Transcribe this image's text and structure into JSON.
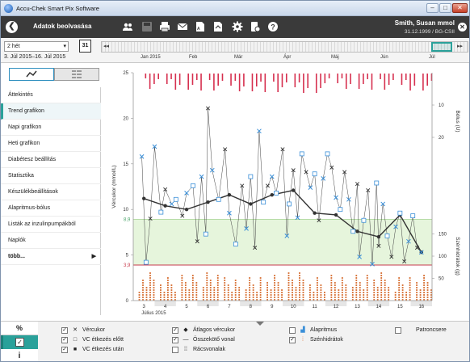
{
  "window": {
    "title": "Accu-Chek Smart Pix Software",
    "min": "–",
    "max": "□",
    "close": "✕"
  },
  "toolbar": {
    "back_icon": "arrow-left-icon",
    "title": "Adatok beolvasása",
    "icons": [
      "users-icon",
      "save-icon",
      "print-icon",
      "mail-icon",
      "pdf-icon",
      "pdf-export-icon",
      "gear-icon",
      "device-settings-icon",
      "help-icon"
    ],
    "user_name": "Smith, Susan mmol",
    "user_sub": "31.12.1999 / BG-CSII",
    "close_icon": "close-icon"
  },
  "range": {
    "period_value": "2 hét",
    "calendar_day": "31",
    "date_range": "3. Júl 2015–16. Júl 2015",
    "months": [
      "Jan 2015",
      "Feb",
      "Már",
      "Ápr",
      "Máj",
      "Jún",
      "Júl"
    ]
  },
  "nav": {
    "items": [
      {
        "label": "Áttekintés"
      },
      {
        "label": "Trend grafikon"
      },
      {
        "label": "Napi grafikon"
      },
      {
        "label": "Heti grafikon"
      },
      {
        "label": "Diabétesz beállítás"
      },
      {
        "label": "Statisztika"
      },
      {
        "label": "Készülékbeállítások"
      },
      {
        "label": "Alapritmus-bólus"
      },
      {
        "label": "Listák az inzulinpumpákból"
      },
      {
        "label": "Naplók"
      },
      {
        "label": "több..."
      }
    ],
    "active_index": 1
  },
  "chart_data": {
    "type": "line",
    "ylabel": "Vércukor (mmol/L)",
    "ylabel_right_top": "Bólus (U)",
    "ylabel_right_bottom": "Szénhidrátok (g)",
    "ylim": [
      0,
      25
    ],
    "yticks": [
      0,
      5,
      10,
      15,
      20,
      25
    ],
    "xlim": [
      2.5,
      16.5
    ],
    "xticks": [
      3,
      4,
      5,
      6,
      7,
      8,
      9,
      10,
      11,
      12,
      13,
      14,
      15,
      16
    ],
    "xsub": "Július 2015",
    "target_range": [
      3.9,
      8.9
    ],
    "target_labels": [
      "3,9",
      "8,9"
    ],
    "bolus_ticks": [
      10,
      20
    ],
    "carb_ticks": [
      50,
      100,
      150
    ],
    "average_line": [
      [
        3,
        11.2
      ],
      [
        4,
        10.4
      ],
      [
        5,
        10.0
      ],
      [
        6,
        10.8
      ],
      [
        7,
        11.6
      ],
      [
        8,
        10.6
      ],
      [
        9,
        11.6
      ],
      [
        10,
        12.1
      ],
      [
        11,
        9.6
      ],
      [
        12,
        9.4
      ],
      [
        13,
        7.6
      ],
      [
        14,
        7.0
      ],
      [
        15,
        9.4
      ],
      [
        16,
        5.3
      ]
    ],
    "glucose_series": [
      {
        "name": "Vércukor",
        "values": [
          [
            2.9,
            15.8
          ],
          [
            3.1,
            4.2
          ],
          [
            3.3,
            9.0
          ],
          [
            3.5,
            16.9
          ],
          [
            3.8,
            9.7
          ],
          [
            4.0,
            12.2
          ],
          [
            4.3,
            10.6
          ],
          [
            4.5,
            11.1
          ],
          [
            4.8,
            9.3
          ],
          [
            5.0,
            11.8
          ],
          [
            5.3,
            12.6
          ],
          [
            5.5,
            6.5
          ],
          [
            5.7,
            13.6
          ],
          [
            5.9,
            7.3
          ],
          [
            6.0,
            21.1
          ],
          [
            6.2,
            14.3
          ],
          [
            6.5,
            11.1
          ],
          [
            6.8,
            16.6
          ],
          [
            7.0,
            9.6
          ],
          [
            7.3,
            6.2
          ],
          [
            7.6,
            12.6
          ],
          [
            7.8,
            7.9
          ],
          [
            8.0,
            13.6
          ],
          [
            8.2,
            5.8
          ],
          [
            8.4,
            18.6
          ],
          [
            8.6,
            10.8
          ],
          [
            8.8,
            12.6
          ],
          [
            9.0,
            13.6
          ],
          [
            9.2,
            11.8
          ],
          [
            9.5,
            16.6
          ],
          [
            9.7,
            7.1
          ],
          [
            9.8,
            10.6
          ],
          [
            10.0,
            14.3
          ],
          [
            10.2,
            9.1
          ],
          [
            10.4,
            16.1
          ],
          [
            10.6,
            14.1
          ],
          [
            10.8,
            12.4
          ],
          [
            11.0,
            13.9
          ],
          [
            11.2,
            8.8
          ],
          [
            11.4,
            13.4
          ],
          [
            11.6,
            16.1
          ],
          [
            11.8,
            14.6
          ],
          [
            12.0,
            11.3
          ],
          [
            12.2,
            10.0
          ],
          [
            12.4,
            14.1
          ],
          [
            12.6,
            11.1
          ],
          [
            12.8,
            7.6
          ],
          [
            13.0,
            12.8
          ],
          [
            13.1,
            4.8
          ],
          [
            13.3,
            8.8
          ],
          [
            13.5,
            12.1
          ],
          [
            13.7,
            4.0
          ],
          [
            13.9,
            12.9
          ],
          [
            14.0,
            6.0
          ],
          [
            14.2,
            10.6
          ],
          [
            14.4,
            7.1
          ],
          [
            14.6,
            4.8
          ],
          [
            14.8,
            8.1
          ],
          [
            15.0,
            9.6
          ],
          [
            15.2,
            4.3
          ],
          [
            15.4,
            6.5
          ],
          [
            15.6,
            9.3
          ],
          [
            15.8,
            5.8
          ],
          [
            16.0,
            5.3
          ]
        ]
      }
    ],
    "bolus_days": 14,
    "carb_days": 14
  },
  "legend": {
    "side": {
      "pct": "%",
      "check": "✓",
      "info": "i"
    },
    "items": [
      {
        "label": "Vércukor",
        "symbol": "✕",
        "checked": true
      },
      {
        "label": "VC étkezés előtt",
        "symbol": "□",
        "checked": true
      },
      {
        "label": "VC étkezés után",
        "symbol": "■",
        "checked": true
      },
      {
        "label": "Átlagos vércukor",
        "symbol": "◆",
        "checked": true
      },
      {
        "label": "Összekötő vonal",
        "symbol": "—",
        "checked": true
      },
      {
        "label": "Rácsvonalak",
        "symbol": "⁞⁞",
        "checked": false
      },
      {
        "label": "Alapritmus",
        "symbol": "▟",
        "checked": false
      },
      {
        "label": "Szénhidrátok",
        "symbol": "⁞",
        "checked": true
      },
      {
        "label": "Patroncsere",
        "symbol": "",
        "checked": false
      }
    ]
  },
  "colors": {
    "accent": "#2aa19a",
    "bolus": "#d6304f",
    "carbs": "#d9773e",
    "target": "#e6f5dc",
    "target_line": "#c73a4c",
    "glucose": "#3a8fd8"
  }
}
